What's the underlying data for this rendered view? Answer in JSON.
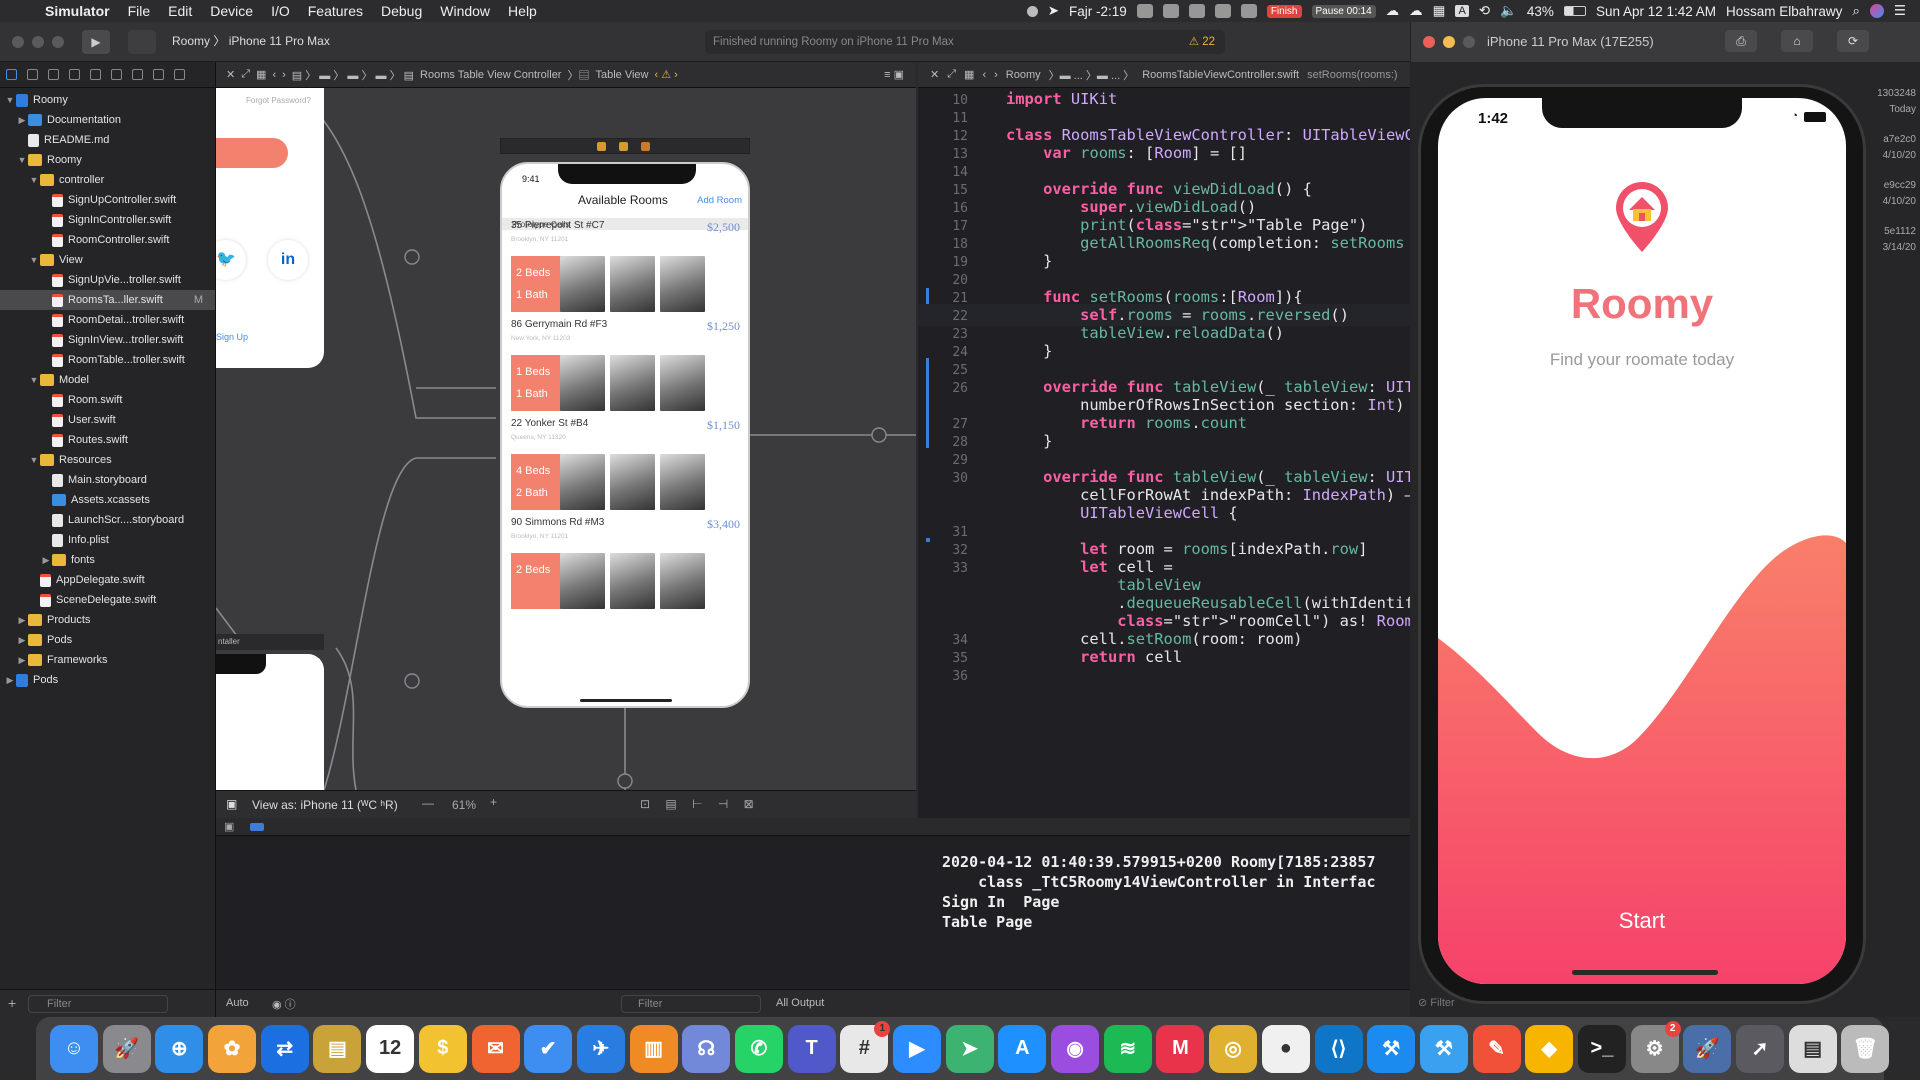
{
  "menubar": {
    "app": "Simulator",
    "items": [
      "File",
      "Edit",
      "Device",
      "I/O",
      "Features",
      "Debug",
      "Window",
      "Help"
    ],
    "prayer": "Fajr -2:19",
    "finish": "Finish",
    "pause": "Pause 00:14",
    "battery": "43%",
    "datetime": "Sun Apr 12  1:42 AM",
    "user": "Hossam Elbahrawy"
  },
  "toolbar": {
    "scheme": "Roomy",
    "device": "iPhone 11 Pro Max",
    "activity": "Finished running Roomy on iPhone 11 Pro Max",
    "warnings": "22"
  },
  "simulator": {
    "title": "iPhone 11 Pro Max (17E255)"
  },
  "navigator": {
    "filter_placeholder": "Filter",
    "rows": [
      {
        "label": "Roomy",
        "depth": 0,
        "tw": "▼",
        "icon": "proj"
      },
      {
        "label": "Documentation",
        "depth": 1,
        "tw": "▶",
        "icon": "bluefolder"
      },
      {
        "label": "README.md",
        "depth": 1,
        "tw": "",
        "icon": "doc"
      },
      {
        "label": "Roomy",
        "depth": 1,
        "tw": "▼",
        "icon": "folder"
      },
      {
        "label": "controller",
        "depth": 2,
        "tw": "▼",
        "icon": "folder"
      },
      {
        "label": "SignUpController.swift",
        "depth": 3,
        "tw": "",
        "icon": "swift"
      },
      {
        "label": "SignInController.swift",
        "depth": 3,
        "tw": "",
        "icon": "swift"
      },
      {
        "label": "RoomController.swift",
        "depth": 3,
        "tw": "",
        "icon": "swift"
      },
      {
        "label": "View",
        "depth": 2,
        "tw": "▼",
        "icon": "folder"
      },
      {
        "label": "SignUpVie...troller.swift",
        "depth": 3,
        "tw": "",
        "icon": "swift"
      },
      {
        "label": "RoomsTa...ller.swift",
        "depth": 3,
        "tw": "",
        "icon": "swift",
        "selected": true,
        "badge": "M"
      },
      {
        "label": "RoomDetai...troller.swift",
        "depth": 3,
        "tw": "",
        "icon": "swift"
      },
      {
        "label": "SignInView...troller.swift",
        "depth": 3,
        "tw": "",
        "icon": "swift"
      },
      {
        "label": "RoomTable...troller.swift",
        "depth": 3,
        "tw": "",
        "icon": "swift"
      },
      {
        "label": "Model",
        "depth": 2,
        "tw": "▼",
        "icon": "folder"
      },
      {
        "label": "Room.swift",
        "depth": 3,
        "tw": "",
        "icon": "swift"
      },
      {
        "label": "User.swift",
        "depth": 3,
        "tw": "",
        "icon": "swift"
      },
      {
        "label": "Routes.swift",
        "depth": 3,
        "tw": "",
        "icon": "swift"
      },
      {
        "label": "Resources",
        "depth": 2,
        "tw": "▼",
        "icon": "folder"
      },
      {
        "label": "Main.storyboard",
        "depth": 3,
        "tw": "",
        "icon": "doc"
      },
      {
        "label": "Assets.xcassets",
        "depth": 3,
        "tw": "",
        "icon": "bluefolder"
      },
      {
        "label": "LaunchScr....storyboard",
        "depth": 3,
        "tw": "",
        "icon": "doc"
      },
      {
        "label": "Info.plist",
        "depth": 3,
        "tw": "",
        "icon": "doc"
      },
      {
        "label": "fonts",
        "depth": 3,
        "tw": "▶",
        "icon": "folder"
      },
      {
        "label": "AppDelegate.swift",
        "depth": 2,
        "tw": "",
        "icon": "swift"
      },
      {
        "label": "SceneDelegate.swift",
        "depth": 2,
        "tw": "",
        "icon": "swift"
      },
      {
        "label": "Products",
        "depth": 1,
        "tw": "▶",
        "icon": "folder"
      },
      {
        "label": "Pods",
        "depth": 1,
        "tw": "▶",
        "icon": "folder"
      },
      {
        "label": "Frameworks",
        "depth": 1,
        "tw": "▶",
        "icon": "folder"
      },
      {
        "label": "Pods",
        "depth": 0,
        "tw": "▶",
        "icon": "proj"
      }
    ]
  },
  "canvas": {
    "breadcrumb": [
      "Rooms Table View Controller",
      "Table View"
    ],
    "forgot": "Forgot Password?",
    "signup": "Sign Up",
    "controller_label": "ntaller",
    "phone": {
      "time": "9:41",
      "title": "Available Rooms",
      "add": "Add Room",
      "proto": "Prototype Cells",
      "cells": [
        {
          "addr": "35 Pierrepont St #C7",
          "sub": "Brooklyn, NY 11201",
          "price": "$2,500",
          "beds": "2 Beds",
          "bath": "1 Bath"
        },
        {
          "addr": "86 Gerrymain Rd #F3",
          "sub": "New York, NY 11203",
          "price": "$1,250",
          "beds": "1 Beds",
          "bath": "1 Bath"
        },
        {
          "addr": "22 Yonker St #B4",
          "sub": "Queens, NY 11320",
          "price": "$1,150",
          "beds": "4 Beds",
          "bath": "2 Bath"
        },
        {
          "addr": "90 Simmons Rd #M3",
          "sub": "Brooklyn, NY 11201",
          "price": "$3,400",
          "beds": "2 Beds",
          "bath": ""
        }
      ]
    },
    "view_as": "View as: iPhone 11 (ᵂC ʰR)",
    "zoom": "61%"
  },
  "editor": {
    "breadcrumb": [
      "Roomy",
      "RoomsTableViewController.swift",
      "setRooms(rooms:)"
    ],
    "lines": [
      {
        "n": "10",
        "t": "import UIKit"
      },
      {
        "n": "11",
        "t": ""
      },
      {
        "n": "12",
        "t": "class RoomsTableViewController: UITableViewC"
      },
      {
        "n": "13",
        "t": "    var rooms: [Room] = []"
      },
      {
        "n": "14",
        "t": ""
      },
      {
        "n": "15",
        "t": "    override func viewDidLoad() {"
      },
      {
        "n": "16",
        "t": "        super.viewDidLoad()"
      },
      {
        "n": "17",
        "t": "        print(\"Table Page\")"
      },
      {
        "n": "18",
        "t": "        getAllRoomsReq(completion: setRooms"
      },
      {
        "n": "19",
        "t": "    }"
      },
      {
        "n": "20",
        "t": ""
      },
      {
        "n": "21",
        "t": "    func setRooms(rooms:[Room]){"
      },
      {
        "n": "22",
        "t": "        self.rooms = rooms.reversed()"
      },
      {
        "n": "23",
        "t": "        tableView.reloadData()"
      },
      {
        "n": "24",
        "t": "    }"
      },
      {
        "n": "25",
        "t": ""
      },
      {
        "n": "26",
        "t": "    override func tableView(_ tableView: UIT"
      },
      {
        "n": "",
        "t": "        numberOfRowsInSection section: Int)"
      },
      {
        "n": "27",
        "t": "        return rooms.count"
      },
      {
        "n": "28",
        "t": "    }"
      },
      {
        "n": "29",
        "t": ""
      },
      {
        "n": "30",
        "t": "    override func tableView(_ tableView: UIT"
      },
      {
        "n": "",
        "t": "        cellForRowAt indexPath: IndexPath) —"
      },
      {
        "n": "",
        "t": "        UITableViewCell {"
      },
      {
        "n": "31",
        "t": ""
      },
      {
        "n": "32",
        "t": "        let room = rooms[indexPath.row]"
      },
      {
        "n": "33",
        "t": "        let cell ="
      },
      {
        "n": "",
        "t": "            tableView"
      },
      {
        "n": "",
        "t": "            .dequeueReusableCell(withIdentif"
      },
      {
        "n": "",
        "t": "            \"roomCell\") as! RoomTableCellVie"
      },
      {
        "n": "34",
        "t": "        cell.setRoom(room: room)"
      },
      {
        "n": "35",
        "t": "        return cell"
      },
      {
        "n": "36",
        "t": ""
      }
    ]
  },
  "console": {
    "lines": [
      "2020-04-12 01:40:39.579915+0200 Roomy[7185:23857",
      "    class _TtC5Roomy14ViewController in Interfac",
      "Sign In  Page",
      "Table Page"
    ],
    "filter": "Filter",
    "auto": "Auto",
    "all_output": "All Output"
  },
  "app": {
    "time": "1:42",
    "title": "Roomy",
    "subtitle": "Find your roomate today",
    "start": "Start"
  },
  "rightstrip": [
    "1303248",
    "Today",
    "a7e2c0",
    "4/10/20",
    "e9cc29",
    "4/10/20",
    "5e1112",
    "3/14/20"
  ],
  "dock": [
    {
      "name": "finder-icon",
      "color": "#3d8ef0",
      "g": "☺"
    },
    {
      "name": "launchpad-icon",
      "color": "#8a8a8e",
      "g": "🚀"
    },
    {
      "name": "safari-icon",
      "color": "#2f8fe8",
      "g": "⊕"
    },
    {
      "name": "photos-icon",
      "color": "#f2a33a",
      "g": "✿"
    },
    {
      "name": "teamviewer-icon",
      "color": "#1b6fe0",
      "g": "⇄"
    },
    {
      "name": "notes-icon",
      "color": "#c9a23a",
      "g": "▤"
    },
    {
      "name": "calendar-icon",
      "color": "#ffffff",
      "g": "12"
    },
    {
      "name": "budget-icon",
      "color": "#f2c230",
      "g": "$"
    },
    {
      "name": "postman-icon",
      "color": "#ef6430",
      "g": "✉"
    },
    {
      "name": "things-icon",
      "color": "#3d8ef0",
      "g": "✔"
    },
    {
      "name": "testflight-icon",
      "color": "#2a7de0",
      "g": "✈"
    },
    {
      "name": "books-icon",
      "color": "#f08a24",
      "g": "▥"
    },
    {
      "name": "discord-icon",
      "color": "#7289da",
      "g": "☊"
    },
    {
      "name": "whatsapp-icon",
      "color": "#25d366",
      "g": "✆"
    },
    {
      "name": "teams-icon",
      "color": "#5059c9",
      "g": "T"
    },
    {
      "name": "slack-icon",
      "color": "#e8e8e8",
      "g": "#",
      "badge": "1"
    },
    {
      "name": "zoom-icon",
      "color": "#2d8cff",
      "g": "▶"
    },
    {
      "name": "pushbullet-icon",
      "color": "#3cb371",
      "g": "➤"
    },
    {
      "name": "appstore-icon",
      "color": "#1e90ff",
      "g": "A"
    },
    {
      "name": "podcasts-icon",
      "color": "#9b4de0",
      "g": "◉"
    },
    {
      "name": "spotify-icon",
      "color": "#1db954",
      "g": "≋"
    },
    {
      "name": "mail-icon",
      "color": "#e8334a",
      "g": "M"
    },
    {
      "name": "chrome-icon",
      "color": "#e0b030",
      "g": "◎"
    },
    {
      "name": "mongodb-icon",
      "color": "#f0f0f0",
      "g": "●"
    },
    {
      "name": "vscode-icon",
      "color": "#0e75c7",
      "g": "⟨⟩"
    },
    {
      "name": "xcode-icon",
      "color": "#1c8bf0",
      "g": "⚒"
    },
    {
      "name": "xcode2-icon",
      "color": "#3aa0f0",
      "g": "⚒"
    },
    {
      "name": "swift-playgrounds-icon",
      "color": "#f05138",
      "g": "✎"
    },
    {
      "name": "sketch-icon",
      "color": "#f7b500",
      "g": "◆"
    },
    {
      "name": "terminal-icon",
      "color": "#222222",
      "g": ">_"
    },
    {
      "name": "system-preferences-icon",
      "color": "#888888",
      "g": "⚙",
      "badge": "2"
    },
    {
      "name": "rocket-typist-icon",
      "color": "#4a6ea8",
      "g": "🚀"
    },
    {
      "name": "rocket-icon",
      "color": "#5a5a60",
      "g": "➚"
    },
    {
      "name": "downloads-stack-icon",
      "color": "#dddddd",
      "g": "▤"
    },
    {
      "name": "trash-icon",
      "color": "#bbbbbb",
      "g": "🗑"
    }
  ]
}
